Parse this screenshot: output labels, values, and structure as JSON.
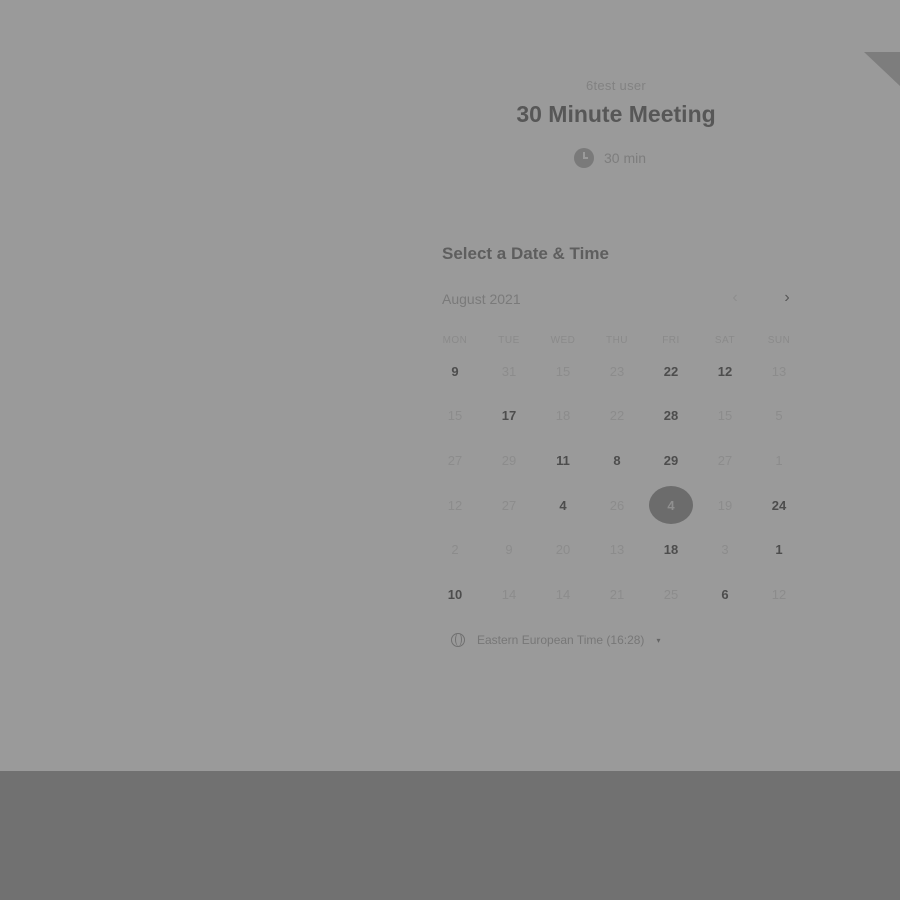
{
  "header": {
    "user": "6test user",
    "title": "30 Minute Meeting",
    "duration": "30 min"
  },
  "calendar": {
    "section_title": "Select a Date & Time",
    "month": "August 2021",
    "prev": "‹",
    "next": "›",
    "weekdays": [
      "MON",
      "TUE",
      "WED",
      "THU",
      "FRI",
      "SAT",
      "SUN"
    ],
    "rows": [
      [
        {
          "d": "9",
          "a": true
        },
        {
          "d": "31",
          "a": false
        },
        {
          "d": "15",
          "a": false
        },
        {
          "d": "23",
          "a": false
        },
        {
          "d": "22",
          "a": true
        },
        {
          "d": "12",
          "a": true
        },
        {
          "d": "13",
          "a": false
        }
      ],
      [
        {
          "d": "15",
          "a": false
        },
        {
          "d": "17",
          "a": true
        },
        {
          "d": "18",
          "a": false
        },
        {
          "d": "22",
          "a": false
        },
        {
          "d": "28",
          "a": true
        },
        {
          "d": "15",
          "a": false
        },
        {
          "d": "5",
          "a": false
        }
      ],
      [
        {
          "d": "27",
          "a": false
        },
        {
          "d": "29",
          "a": false
        },
        {
          "d": "11",
          "a": true
        },
        {
          "d": "8",
          "a": true
        },
        {
          "d": "29",
          "a": true
        },
        {
          "d": "27",
          "a": false
        },
        {
          "d": "1",
          "a": false
        }
      ],
      [
        {
          "d": "12",
          "a": false
        },
        {
          "d": "27",
          "a": false
        },
        {
          "d": "4",
          "a": true
        },
        {
          "d": "26",
          "a": false
        },
        {
          "d": "4",
          "a": true,
          "s": true
        },
        {
          "d": "19",
          "a": false
        },
        {
          "d": "24",
          "a": true
        }
      ],
      [
        {
          "d": "2",
          "a": false
        },
        {
          "d": "9",
          "a": false
        },
        {
          "d": "20",
          "a": false
        },
        {
          "d": "13",
          "a": false
        },
        {
          "d": "18",
          "a": true
        },
        {
          "d": "3",
          "a": false
        },
        {
          "d": "1",
          "a": true
        }
      ],
      [
        {
          "d": "10",
          "a": true
        },
        {
          "d": "14",
          "a": false
        },
        {
          "d": "14",
          "a": false
        },
        {
          "d": "21",
          "a": false
        },
        {
          "d": "25",
          "a": false
        },
        {
          "d": "6",
          "a": true
        },
        {
          "d": "12",
          "a": false
        }
      ]
    ]
  },
  "timezone": {
    "label": "Eastern European Time (16:28)",
    "caret": "▾"
  },
  "icons": {
    "duration": "clock-icon",
    "timezone": "globe-icon"
  }
}
